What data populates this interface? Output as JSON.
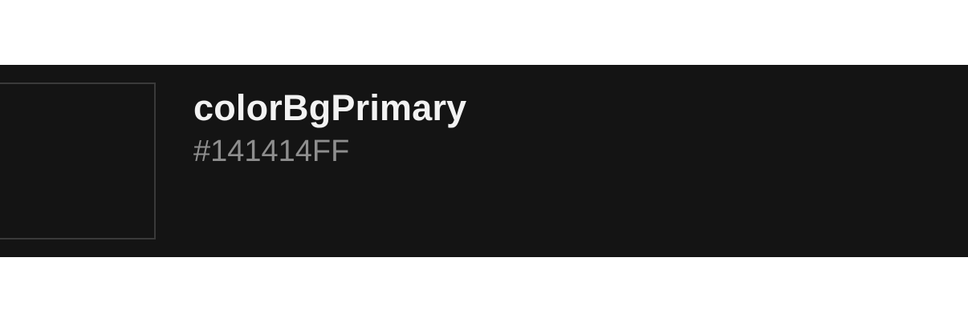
{
  "token": {
    "name": "colorBgPrimary",
    "value": "#141414FF"
  },
  "colors": {
    "swatch_fill": "#141414",
    "row_background": "#141414",
    "page_background": "#FFFFFF",
    "name_text": "#F2F2F2",
    "value_text": "#8E8E8E"
  }
}
